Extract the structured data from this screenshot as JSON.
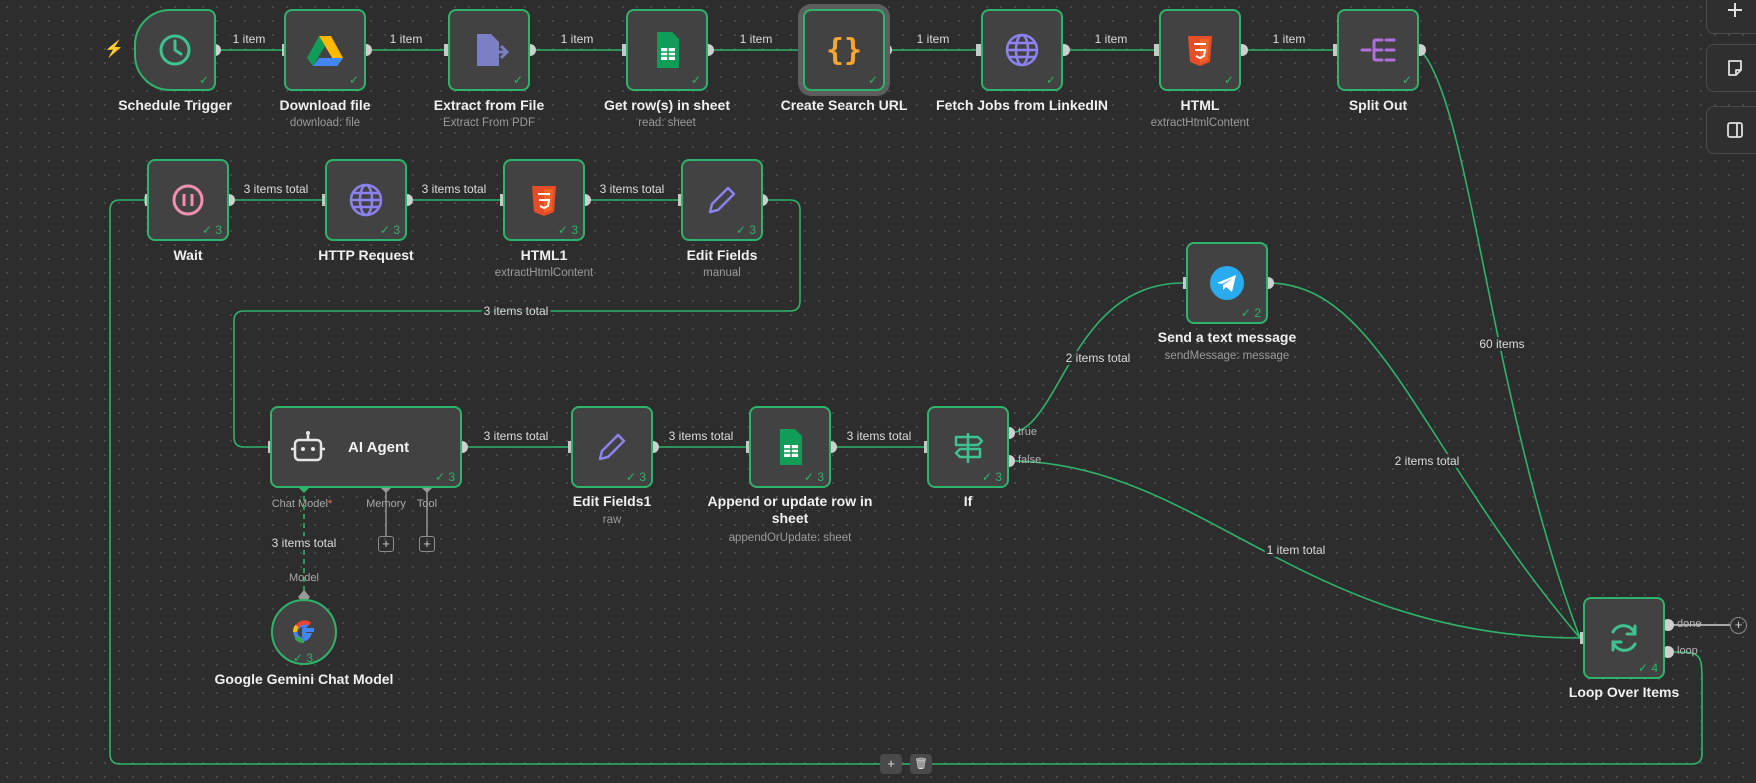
{
  "nodes": {
    "schedule_trigger": {
      "title": "Schedule Trigger",
      "icon": "clock-icon"
    },
    "download_file": {
      "title": "Download file",
      "subtitle": "download: file",
      "icon": "google-drive-icon"
    },
    "extract_from_file": {
      "title": "Extract from File",
      "subtitle": "Extract From PDF",
      "icon": "file-extract-icon"
    },
    "get_rows": {
      "title": "Get row(s) in sheet",
      "subtitle": "read: sheet",
      "icon": "google-sheets-icon"
    },
    "create_search_url": {
      "title": "Create Search URL",
      "icon": "code-braces-icon"
    },
    "fetch_jobs": {
      "title": "Fetch Jobs from LinkedIN",
      "icon": "globe-icon"
    },
    "html": {
      "title": "HTML",
      "subtitle": "extractHtmlContent",
      "icon": "html5-icon"
    },
    "split_out": {
      "title": "Split Out",
      "icon": "split-out-icon"
    },
    "wait": {
      "title": "Wait",
      "icon": "pause-icon",
      "count": "3"
    },
    "http_request": {
      "title": "HTTP Request",
      "icon": "globe-icon",
      "count": "3"
    },
    "html1": {
      "title": "HTML1",
      "subtitle": "extractHtmlContent",
      "icon": "html5-icon",
      "count": "3"
    },
    "edit_fields": {
      "title": "Edit Fields",
      "subtitle": "manual",
      "icon": "pencil-icon",
      "count": "3"
    },
    "ai_agent": {
      "title": "AI Agent",
      "icon": "robot-icon",
      "count": "3"
    },
    "edit_fields1": {
      "title": "Edit Fields1",
      "subtitle": "raw",
      "icon": "pencil-icon",
      "count": "3"
    },
    "append_row": {
      "title": "Append or update row in sheet",
      "subtitle": "appendOrUpdate: sheet",
      "icon": "google-sheets-icon",
      "count": "3"
    },
    "if": {
      "title": "If",
      "icon": "signpost-icon",
      "count": "3"
    },
    "send_message": {
      "title": "Send a text message",
      "subtitle": "sendMessage: message",
      "icon": "telegram-icon",
      "count": "2"
    },
    "loop_over_items": {
      "title": "Loop Over Items",
      "icon": "refresh-icon",
      "count": "4"
    },
    "gemini": {
      "title": "Google Gemini Chat Model",
      "icon": "google-g-icon",
      "count": "3"
    }
  },
  "edge_labels": {
    "e1": "1 item",
    "e2": "1 item",
    "e3": "1 item",
    "e4": "1 item",
    "e5": "1 item",
    "e6": "1 item",
    "e7": "1 item",
    "e8": "3 items total",
    "e9": "3 items total",
    "e10": "3 items total",
    "e11": "3 items total",
    "e12": "3 items total",
    "e13": "3 items total",
    "e14": "3 items total",
    "e15": "2 items total",
    "e16": "60 items",
    "e17": "2 items total",
    "e18": "1 item total",
    "e19": "3 items total"
  },
  "ports": {
    "true": "true",
    "false": "false",
    "done": "done",
    "loop": "loop"
  },
  "agent_slots": {
    "chat_model": "Chat Model",
    "required_mark": "*",
    "memory": "Memory",
    "tool": "Tool",
    "model": "Model"
  },
  "check_mark": "✓",
  "toolbar": {
    "add": "+",
    "delete": "🗑"
  },
  "colors": {
    "success": "#2eb36b",
    "canvas": "#2d2d2d",
    "node": "#424242",
    "trigger_bolt": "#ff6d5a"
  }
}
